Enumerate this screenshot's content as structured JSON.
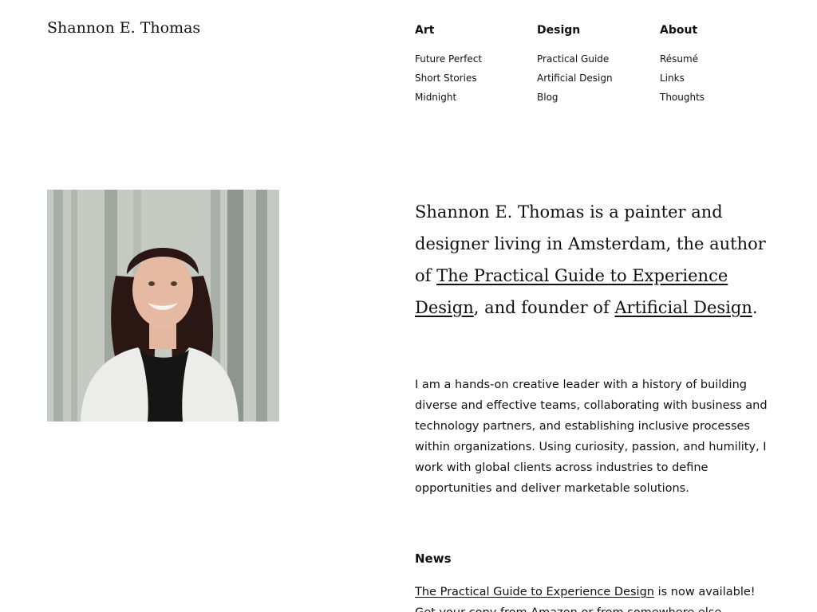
{
  "site": {
    "title": "Shannon E. Thomas"
  },
  "nav": {
    "art": {
      "heading": "Art",
      "items": [
        "Future Perfect",
        "Short Stories",
        "Midnight"
      ]
    },
    "design": {
      "heading": "Design",
      "items": [
        "Practical Guide",
        "Artificial Design",
        "Blog"
      ]
    },
    "about": {
      "heading": "About",
      "items": [
        "Résumé",
        "Links",
        "Thoughts"
      ]
    }
  },
  "portrait": {
    "icon": "portrait-photo",
    "colors": {
      "background": "#c5cbc2",
      "trees": "#7f8a84",
      "hair": "#2a1714",
      "jacket": "#ececea",
      "top": "#151515",
      "skin": "#e6b9a2"
    }
  },
  "intro": {
    "part1": "Shannon E. Thomas is a painter and designer living in Amsterdam, the author of ",
    "book_link": "The Practical Guide to Experience Design",
    "part2": ", and founder of ",
    "company_link": "Artificial Design",
    "part3": "."
  },
  "bio": {
    "text": "I am a hands-on creative leader with a history of building diverse and effective teams, collaborating with business and technology partners, and establishing inclusive processes within organizations. Using curiosity, passion, and humility, I work with global clients across industries to define opportunities and deliver marketable solutions."
  },
  "news": {
    "heading": "News",
    "book_link": "The Practical Guide to Experience Design",
    "text1": " is now available! Get your copy from Amazon or from somewhere else."
  }
}
